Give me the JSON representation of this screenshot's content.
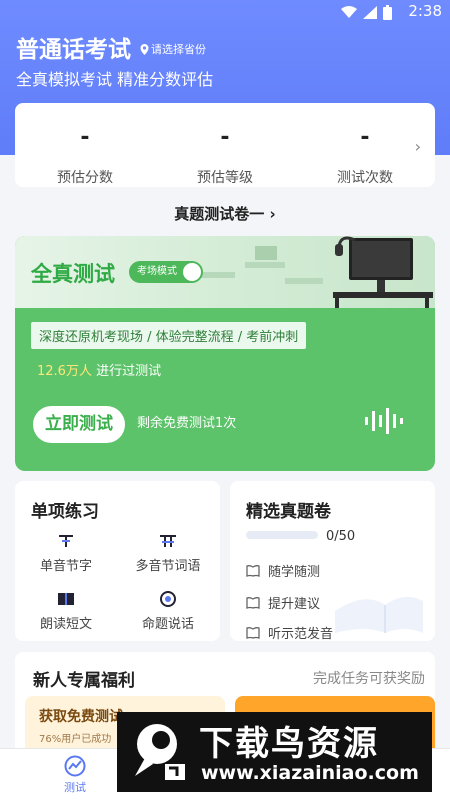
{
  "status_bar": {
    "time": "2:38"
  },
  "header": {
    "title": "普通话考试",
    "province_label": "请选择省份",
    "subtitle": "全真模拟考试 精准分数评估"
  },
  "stats": [
    {
      "value": "-",
      "label": "预估分数"
    },
    {
      "value": "-",
      "label": "预估等级"
    },
    {
      "value": "-",
      "label": "测试次数"
    }
  ],
  "exam_link": "真题测试卷一",
  "mock_test": {
    "title": "全真测试",
    "toggle_label": "考场模式",
    "toggle_on": true,
    "tagline": "深度还原机考现场 / 体验完整流程 / 考前冲刺",
    "count_number": "12.6万人",
    "count_suffix": "进行过测试",
    "start_button": "立即测试",
    "free_remaining": "剩余免费测试1次"
  },
  "single_practice": {
    "title": "单项练习",
    "items": [
      {
        "label": "单音节字",
        "icon": "single-char-icon"
      },
      {
        "label": "多音节词语",
        "icon": "multi-char-icon"
      },
      {
        "label": "朗读短文",
        "icon": "book-icon"
      },
      {
        "label": "命题说话",
        "icon": "speech-icon"
      }
    ]
  },
  "selected_papers": {
    "title": "精选真题卷",
    "progress_text": "0/50",
    "progress": 0,
    "items": [
      "随学随测",
      "提升建议",
      "听示范发音"
    ]
  },
  "newbie_benefits": {
    "title": "新人专属福利",
    "right_text": "完成任务可获奖励",
    "task_title": "获取免费测试",
    "task_sub": "76%用户已成功"
  },
  "tabbar": {
    "tabs": [
      {
        "label": "测试"
      }
    ]
  },
  "watermark": {
    "cn": "下载鸟资源",
    "url": "www.xiazainiao.com"
  },
  "colors": {
    "header_blue": "#6f8bff",
    "accent_green": "#5dc36a",
    "tab_active": "#5a78f0",
    "benefit_orange": "#ffa52a"
  }
}
